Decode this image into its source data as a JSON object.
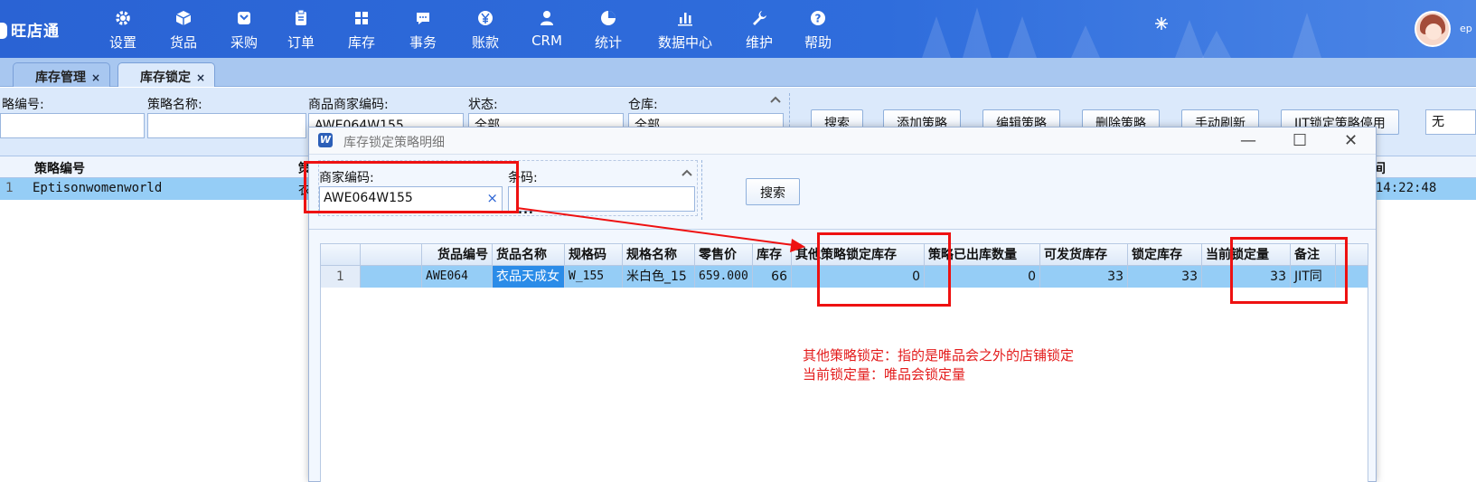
{
  "app": {
    "logo": "旺店通",
    "user": "ep"
  },
  "nav": [
    {
      "label": "设置",
      "icon": "gear-icon"
    },
    {
      "label": "货品",
      "icon": "box-icon"
    },
    {
      "label": "采购",
      "icon": "cart-icon"
    },
    {
      "label": "订单",
      "icon": "clipboard-icon"
    },
    {
      "label": "库存",
      "icon": "grid-icon"
    },
    {
      "label": "事务",
      "icon": "chat-icon"
    },
    {
      "label": "账款",
      "icon": "yen-icon"
    },
    {
      "label": "CRM",
      "icon": "person-icon"
    },
    {
      "label": "统计",
      "icon": "pie-icon"
    },
    {
      "label": "数据中心",
      "icon": "bar-chart-icon"
    },
    {
      "label": "维护",
      "icon": "wrench-icon"
    },
    {
      "label": "帮助",
      "icon": "help-icon"
    }
  ],
  "tabs": [
    {
      "label": "库存管理",
      "close": "×"
    },
    {
      "label": "库存锁定",
      "close": "×"
    }
  ],
  "filters": {
    "strategy_no": "略编号:",
    "strategy_name": "策略名称:",
    "merchant_code": "商品商家编码:",
    "merchant_code_value": "AWE064W155",
    "status": "状态:",
    "status_value": "全部",
    "warehouse": "仓库:",
    "warehouse_value": "全部",
    "extra_value": "无"
  },
  "toolbar": {
    "search": "搜索",
    "add": "添加策略",
    "edit": "编辑策略",
    "delete": "删除策略",
    "refresh": "手动刷新",
    "jit": "JIT锁定策略停用"
  },
  "main_grid": {
    "headers": [
      "策略编号",
      "策",
      "时间"
    ],
    "row": {
      "index": "1",
      "strategy_no": "Eptisonwomenworld",
      "partial": "衣",
      "time": "7 14:22:48"
    }
  },
  "dialog": {
    "title": "库存锁定策略明细",
    "merchant_code_label": "商家编码:",
    "merchant_code_value": "AWE064W155",
    "clear": "×",
    "barcode_label": "条码:",
    "more": "...",
    "search": "搜索",
    "columns": [
      "货品编号",
      "货品名称",
      "规格码",
      "规格名称",
      "零售价",
      "库存",
      "其他策略锁定库存",
      "策略已出库数量",
      "可发货库存",
      "锁定库存",
      "当前锁定量",
      "备注"
    ],
    "row": {
      "index": "1",
      "goods_no": "AWE064",
      "goods_name": "衣品天成女",
      "spec_code": "W_155",
      "spec_name": "米白色_15",
      "price": "659.000",
      "stock": "66",
      "other_locked": "0",
      "shipped": "0",
      "available": "33",
      "locked": "33",
      "current_locked": "33",
      "remark": "JIT同"
    }
  },
  "annotation": {
    "line1": "其他策略锁定：指的是唯品会之外的店铺锁定",
    "line2": "当前锁定量：唯品会锁定量"
  },
  "colors": {
    "nav_bg": "#2f6ddc",
    "selected_row": "#95cdf6",
    "annotation": "#ee1111"
  }
}
